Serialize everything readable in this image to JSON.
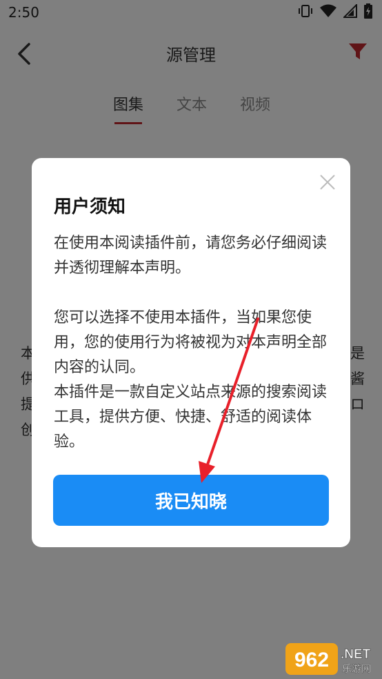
{
  "status_bar": {
    "time": "2:50",
    "icons": [
      "vibrate-icon",
      "wifi-icon",
      "signal-icon",
      "battery-icon"
    ]
  },
  "app_bar": {
    "back_icon": "back-arrow-icon",
    "title": "源管理",
    "filter_icon": "filter-icon",
    "filter_color": "#c0282e"
  },
  "tabs": [
    {
      "label": "图集",
      "active": true
    },
    {
      "label": "文本",
      "active": false
    },
    {
      "label": "视频",
      "active": false
    }
  ],
  "background_page": {
    "left_chars": [
      "本",
      "供",
      "提",
      "创"
    ],
    "right_chars": [
      "是",
      "酱",
      "ロ"
    ]
  },
  "dialog": {
    "title": "用户须知",
    "close_icon": "close-icon",
    "paragraph_1": "在使用本阅读插件前，请您务必仔细阅读并透彻理解本声明。",
    "paragraph_2": "您可以选择不使用本插件，当如果您使用，您的使用行为将被视为对本声明全部内容的认同。",
    "paragraph_3": "本插件是一款自定义站点来源的搜索阅读工具，提供方便、快捷、舒适的阅读体验。",
    "confirm_label": "我已知晓",
    "confirm_color": "#1a8cf5"
  },
  "annotation": {
    "arrow_color": "#e8202a"
  },
  "watermark": {
    "number": "962",
    "suffix": ".NET",
    "subtitle": "乐游网"
  }
}
